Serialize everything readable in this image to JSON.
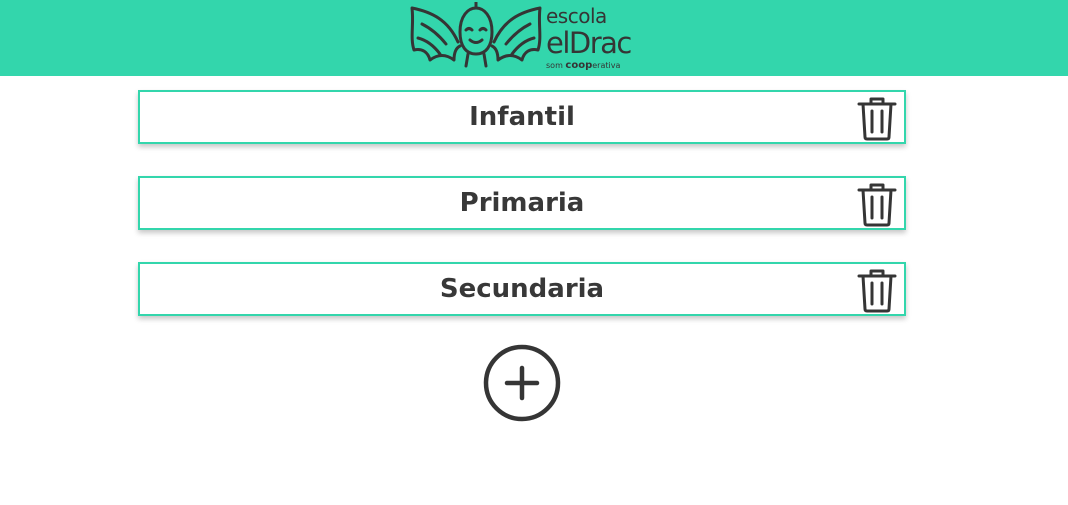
{
  "header": {
    "logo": {
      "line1": "escola",
      "line2": "elDrac",
      "line3_prefix": "som ",
      "line3_coop": "coop",
      "line3_suffix": "erativa"
    }
  },
  "colors": {
    "brand": "#33d6ac",
    "text": "#383838",
    "icon": "#353535"
  },
  "stages": [
    {
      "label": "Infantil",
      "icon": "trash-icon"
    },
    {
      "label": "Primaria",
      "icon": "trash-icon"
    },
    {
      "label": "Secundaria",
      "icon": "trash-icon"
    }
  ],
  "add_button": {
    "icon": "plus-circle-icon"
  }
}
